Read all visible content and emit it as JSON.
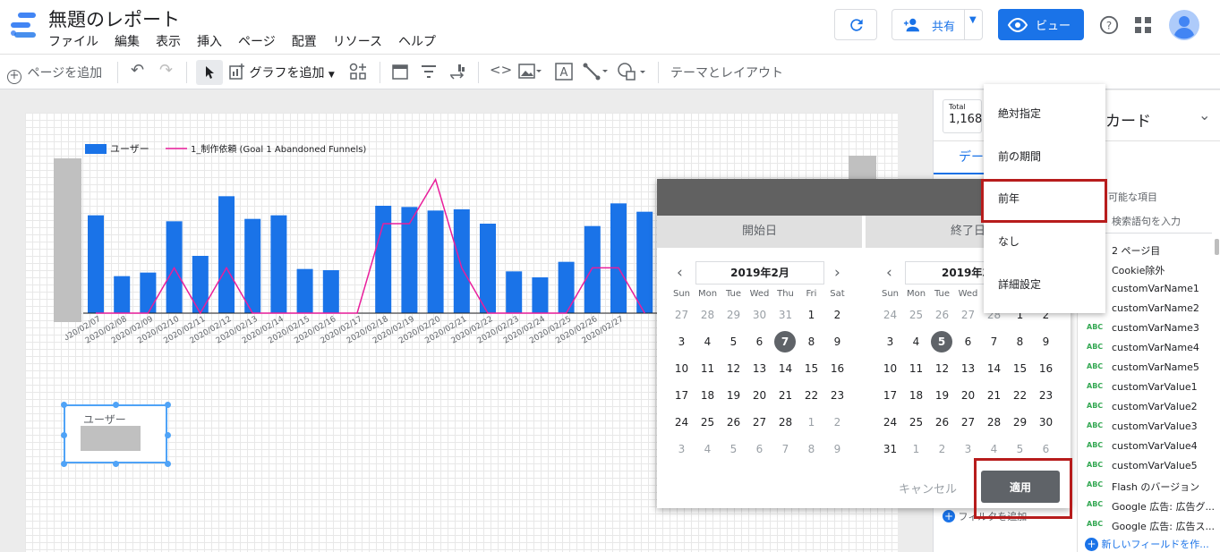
{
  "app": {
    "title": "無題のレポート",
    "menus": [
      "ファイル",
      "編集",
      "表示",
      "挿入",
      "ページ",
      "配置",
      "リソース",
      "ヘルプ"
    ],
    "share_label": "共有",
    "view_label": "ビュー"
  },
  "toolbar": {
    "add_page": "ページを追加",
    "add_chart": "グラフを追加",
    "theme_layout": "テーマとレイアウト"
  },
  "chart_data": {
    "type": "bar",
    "categories": [
      "2020/02/07",
      "2020/02/08",
      "2020/02/09",
      "2020/02/10",
      "2020/02/11",
      "2020/02/12",
      "2020/02/13",
      "2020/02/14",
      "2020/02/15",
      "2020/02/16",
      "2020/02/17",
      "2020/02/18",
      "2020/02/19",
      "2020/02/20",
      "2020/02/21",
      "2020/02/22",
      "2020/02/23",
      "2020/02/24",
      "2020/02/25",
      "2020/02/26",
      "2020/02/27"
    ],
    "series": [
      {
        "name": "ユーザー",
        "type": "bar",
        "values": [
          82,
          31,
          34,
          77,
          48,
          98,
          79,
          82,
          37,
          36,
          0,
          90,
          89,
          86,
          87,
          75,
          35,
          30,
          43,
          73,
          92,
          85
        ]
      },
      {
        "name": "1_制作依頼 (Goal 1 Abandoned Funnels)",
        "type": "line",
        "values": [
          0,
          0,
          0,
          38,
          0,
          38,
          0,
          0,
          0,
          0,
          0,
          75,
          75,
          112,
          38,
          0,
          0,
          0,
          0,
          38,
          38,
          0
        ]
      }
    ],
    "series_names": [
      "ユーザー",
      "1_制作依頼 (Goal 1 Abandoned Funnels)"
    ],
    "colors": {
      "bar": "#1a73e8",
      "line": "#e91e9b"
    }
  },
  "scorecard": {
    "label": "ユーザー"
  },
  "right_panel": {
    "total_label": "Total",
    "total_value": "1,168",
    "card_title": "カード",
    "tab_data": "デー",
    "available_fields": "可能な項目",
    "search_placeholder": "検索語句を入力",
    "fields": [
      "2 ページ目",
      "Cookie除外",
      "customVarName1",
      "customVarName2",
      "customVarName3",
      "customVarName4",
      "customVarName5",
      "customVarValue1",
      "customVarValue2",
      "customVarValue3",
      "customVarValue4",
      "customVarValue5",
      "Flash のバージョン",
      "Google 広告: 広告グ...",
      "Google 広告: 広告ス..."
    ],
    "add_filter": "フィルタを追加",
    "new_field": "新しいフィールドを作..."
  },
  "date_picker": {
    "tab_start": "開始日",
    "tab_end": "終了日",
    "left_month": "2019年2月",
    "right_month": "2019年3",
    "dow": [
      "Sun",
      "Mon",
      "Tue",
      "Wed",
      "Thu",
      "Fri",
      "Sat"
    ],
    "left_days": [
      [
        "27",
        "28",
        "29",
        "30",
        "31",
        "1",
        "2"
      ],
      [
        "3",
        "4",
        "5",
        "6",
        "7",
        "8",
        "9"
      ],
      [
        "10",
        "11",
        "12",
        "13",
        "14",
        "15",
        "16"
      ],
      [
        "17",
        "18",
        "19",
        "20",
        "21",
        "22",
        "23"
      ],
      [
        "24",
        "25",
        "26",
        "27",
        "28",
        "1",
        "2"
      ],
      [
        "3",
        "4",
        "5",
        "6",
        "7",
        "8",
        "9"
      ]
    ],
    "right_days": [
      [
        "24",
        "25",
        "26",
        "27",
        "28",
        "1",
        "2"
      ],
      [
        "3",
        "4",
        "5",
        "6",
        "7",
        "8",
        "9"
      ],
      [
        "10",
        "11",
        "12",
        "13",
        "14",
        "15",
        "16"
      ],
      [
        "17",
        "18",
        "19",
        "20",
        "21",
        "22",
        "23"
      ],
      [
        "24",
        "25",
        "26",
        "27",
        "28",
        "29",
        "30"
      ],
      [
        "31",
        "1",
        "2",
        "3",
        "4",
        "5",
        "6"
      ]
    ],
    "left_selected": "7",
    "right_selected": "5",
    "cancel": "キャンセル",
    "apply": "適用"
  },
  "compare_menu": {
    "items": [
      "絶対指定",
      "前の期間",
      "前年",
      "なし",
      "詳細設定"
    ],
    "highlighted": "前年"
  }
}
